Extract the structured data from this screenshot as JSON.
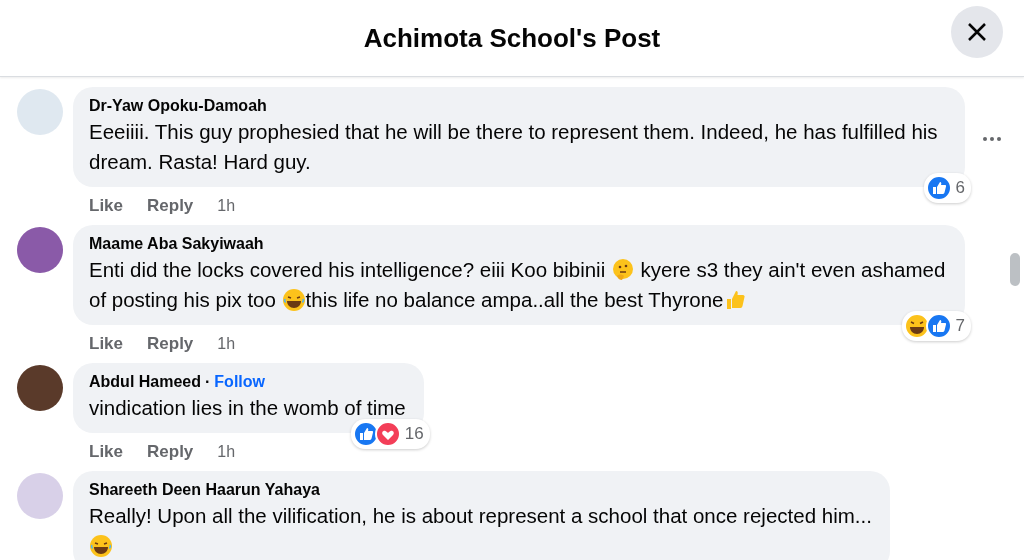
{
  "header": {
    "title": "Achimota School's Post"
  },
  "comments": [
    {
      "author": "Dr-Yaw Opoku-Damoah",
      "body": [
        {
          "kind": "text",
          "text": "Eeeiiii. This guy prophesied that he will be there to represent them. Indeed, he has fulfilled his dream. Rasta! Hard guy."
        }
      ],
      "reactions": [
        {
          "kind": "like"
        }
      ],
      "reaction_count": "6",
      "more": true,
      "actions": [
        "Like",
        "Reply"
      ],
      "time": "1h"
    },
    {
      "author": "Maame Aba Sakyiwaah",
      "body": [
        {
          "kind": "text",
          "text": "Enti did the locks covered his intelligence? eiii Koo bibinii "
        },
        {
          "kind": "thinking"
        },
        {
          "kind": "text",
          "text": " kyere s3 they ain't even ashamed of posting his pix too "
        },
        {
          "kind": "laughing"
        },
        {
          "kind": "text",
          "text": "this life no balance ampa..all the best Thyrone"
        },
        {
          "kind": "thumbsup"
        }
      ],
      "reactions": [
        {
          "kind": "haha"
        },
        {
          "kind": "like"
        }
      ],
      "reaction_count": "7",
      "actions": [
        "Like",
        "Reply"
      ],
      "time": "1h"
    },
    {
      "author": "Abdul Hameed",
      "separator": "·",
      "follow": "Follow",
      "body": [
        {
          "kind": "text",
          "text": "vindication lies in the womb of time"
        }
      ],
      "reactions": [
        {
          "kind": "like"
        },
        {
          "kind": "love"
        }
      ],
      "reaction_count": "16",
      "actions": [
        "Like",
        "Reply"
      ],
      "time": "1h"
    },
    {
      "author": "Shareeth Deen Haarun Yahaya",
      "body": [
        {
          "kind": "text",
          "text": "Really! Upon all the vilification, he is about represent a school that once rejected him..."
        },
        {
          "kind": "break"
        },
        {
          "kind": "laughing"
        }
      ]
    }
  ]
}
